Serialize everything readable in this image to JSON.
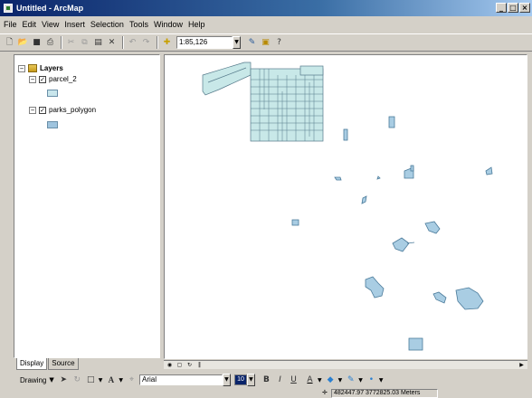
{
  "window": {
    "title": "Untitled - ArcMap",
    "controls": [
      "_",
      "□",
      "×"
    ]
  },
  "menu": [
    "File",
    "Edit",
    "View",
    "Insert",
    "Selection",
    "Tools",
    "Window",
    "Help"
  ],
  "toolbar": {
    "icons": [
      "new-icon",
      "open-icon",
      "save-icon",
      "print-icon",
      "cut-icon",
      "copy-icon",
      "paste-icon",
      "delete-icon",
      "undo-icon",
      "redo-icon",
      "add-data-icon"
    ],
    "scale": "1:85,126",
    "extra_icons": [
      "editor-toolbar-icon",
      "arccatalog-icon",
      "whats-this-icon"
    ]
  },
  "toc": {
    "root_label": "Layers",
    "layers": [
      {
        "name": "parcel_2",
        "checked": true,
        "swatch_color": "#c9e6ec"
      },
      {
        "name": "parks_polygon",
        "checked": true,
        "swatch_color": "#9fc4de"
      }
    ],
    "tabs": [
      "Display",
      "Source"
    ],
    "active_tab": "Display"
  },
  "map": {
    "parcel_fill": "#c8e8e8",
    "parcel_stroke": "#557a8a",
    "park_fill": "#a9cde3",
    "park_stroke": "#4a7a9a"
  },
  "drawing": {
    "label": "Drawing",
    "text_tool": "A",
    "font": "Arial",
    "size": "10",
    "format_buttons": [
      "B",
      "I",
      "U"
    ]
  },
  "status": {
    "coordinates": "482447.97  3772825.03 Meters"
  }
}
